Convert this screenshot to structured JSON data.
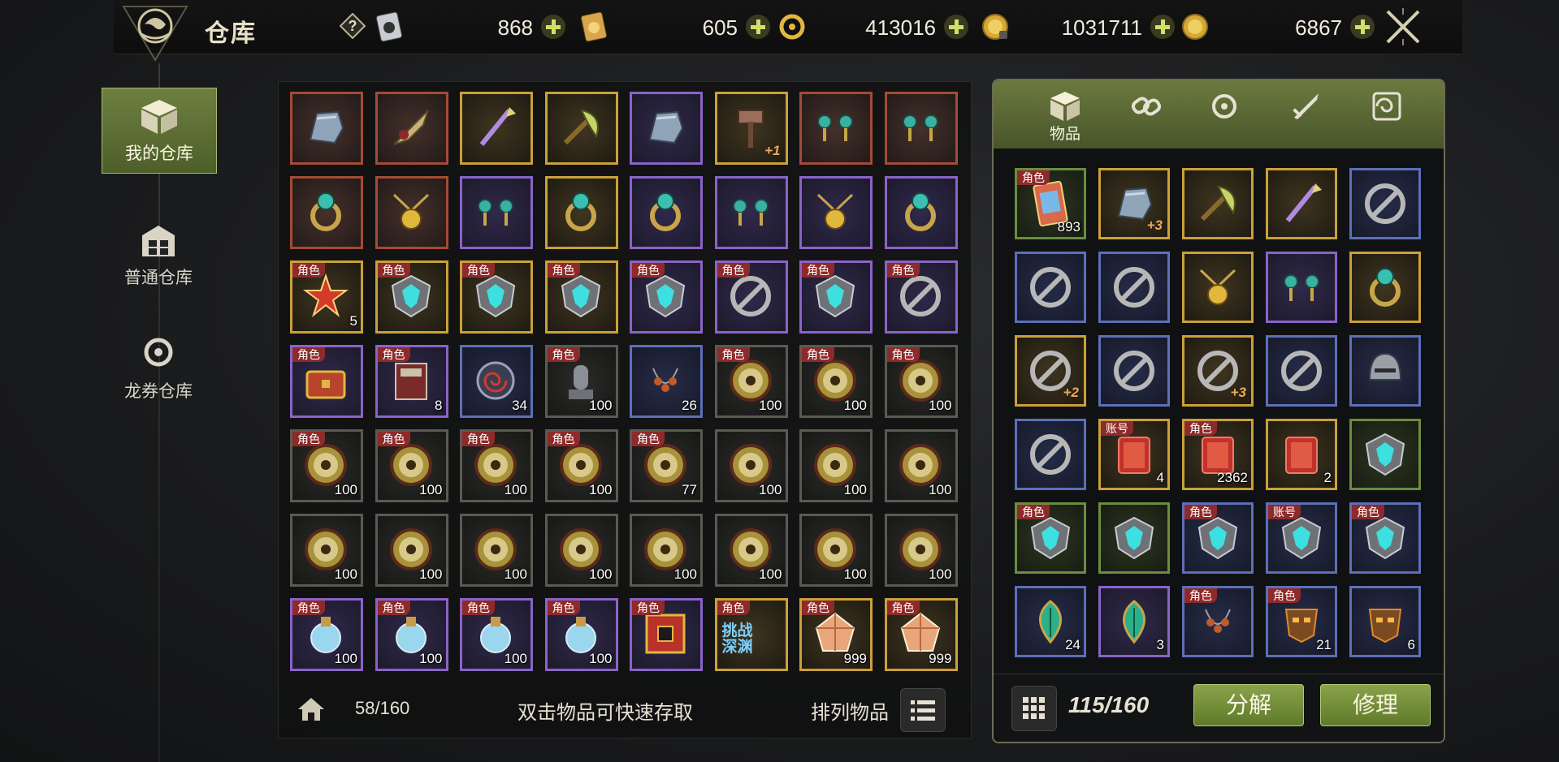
{
  "header": {
    "title": "仓库",
    "currencies": [
      {
        "icon": "ticket-card-icon",
        "value": "868"
      },
      {
        "icon": "coupon-card-icon",
        "value": "605"
      },
      {
        "icon": "dragon-coupon-icon",
        "value": "413016"
      },
      {
        "icon": "bound-gold-icon",
        "value": "1031711"
      },
      {
        "icon": "gold-coin-icon",
        "value": "6867"
      }
    ]
  },
  "nav": {
    "items": [
      {
        "label": "我的仓库",
        "icon": "box-icon",
        "active": true
      },
      {
        "label": "普通仓库",
        "icon": "warehouse-icon",
        "active": false
      },
      {
        "label": "龙券仓库",
        "icon": "dragon-coupon-icon",
        "active": false
      }
    ]
  },
  "left_grid": {
    "slots": [
      {
        "q": "red",
        "art": "gauntlet"
      },
      {
        "q": "red",
        "art": "blade"
      },
      {
        "q": "gold",
        "art": "spear"
      },
      {
        "q": "gold",
        "art": "axe"
      },
      {
        "q": "purple",
        "art": "gauntlet"
      },
      {
        "q": "gold",
        "art": "hammer",
        "enh": "+1"
      },
      {
        "q": "red",
        "art": "earring"
      },
      {
        "q": "red",
        "art": "earring"
      },
      {
        "q": "red",
        "art": "ring"
      },
      {
        "q": "red",
        "art": "amulet"
      },
      {
        "q": "purple",
        "art": "earring"
      },
      {
        "q": "gold",
        "art": "ring"
      },
      {
        "q": "purple",
        "art": "ring"
      },
      {
        "q": "purple",
        "art": "earring"
      },
      {
        "q": "purple",
        "art": "amulet"
      },
      {
        "q": "purple",
        "art": "ring"
      },
      {
        "q": "gold",
        "art": "star",
        "tag": "角色",
        "cnt": "5"
      },
      {
        "q": "gold",
        "art": "shield",
        "tag": "角色"
      },
      {
        "q": "gold",
        "art": "shield",
        "tag": "角色"
      },
      {
        "q": "gold",
        "art": "shield",
        "tag": "角色"
      },
      {
        "q": "purple",
        "art": "shield",
        "tag": "角色"
      },
      {
        "q": "purple",
        "art": "ban",
        "tag": "角色"
      },
      {
        "q": "purple",
        "art": "shield",
        "tag": "角色"
      },
      {
        "q": "purple",
        "art": "ban",
        "tag": "角色"
      },
      {
        "q": "purple",
        "art": "chest",
        "tag": "角色"
      },
      {
        "q": "purple",
        "art": "book",
        "tag": "角色",
        "cnt": "8"
      },
      {
        "q": "blue",
        "art": "spiral",
        "cnt": "34"
      },
      {
        "q": "dark",
        "art": "statue",
        "tag": "角色",
        "cnt": "100"
      },
      {
        "q": "blue",
        "art": "beads",
        "cnt": "26"
      },
      {
        "q": "dark",
        "art": "medal",
        "tag": "角色",
        "cnt": "100"
      },
      {
        "q": "dark",
        "art": "medal",
        "tag": "角色",
        "cnt": "100"
      },
      {
        "q": "dark",
        "art": "medal",
        "tag": "角色",
        "cnt": "100"
      },
      {
        "q": "dark",
        "art": "medal",
        "tag": "角色",
        "cnt": "100"
      },
      {
        "q": "dark",
        "art": "medal",
        "tag": "角色",
        "cnt": "100"
      },
      {
        "q": "dark",
        "art": "medal",
        "tag": "角色",
        "cnt": "100"
      },
      {
        "q": "dark",
        "art": "medal",
        "tag": "角色",
        "cnt": "100"
      },
      {
        "q": "dark",
        "art": "medal",
        "tag": "角色",
        "cnt": "77"
      },
      {
        "q": "dark",
        "art": "medal",
        "cnt": "100"
      },
      {
        "q": "dark",
        "art": "medal",
        "cnt": "100"
      },
      {
        "q": "dark",
        "art": "medal",
        "cnt": "100"
      },
      {
        "q": "dark",
        "art": "medal",
        "cnt": "100"
      },
      {
        "q": "dark",
        "art": "medal",
        "cnt": "100"
      },
      {
        "q": "dark",
        "art": "medal",
        "cnt": "100"
      },
      {
        "q": "dark",
        "art": "medal",
        "cnt": "100"
      },
      {
        "q": "dark",
        "art": "medal",
        "cnt": "100"
      },
      {
        "q": "dark",
        "art": "medal",
        "cnt": "100"
      },
      {
        "q": "dark",
        "art": "medal",
        "cnt": "100"
      },
      {
        "q": "dark",
        "art": "medal",
        "cnt": "100"
      },
      {
        "q": "purple",
        "art": "potion",
        "tag": "角色",
        "cnt": "100"
      },
      {
        "q": "purple",
        "art": "potion",
        "tag": "角色",
        "cnt": "100"
      },
      {
        "q": "purple",
        "art": "potion",
        "tag": "角色",
        "cnt": "100"
      },
      {
        "q": "purple",
        "art": "potion",
        "tag": "角色",
        "cnt": "100"
      },
      {
        "q": "purple",
        "art": "cube",
        "tag": "角色"
      },
      {
        "q": "gold",
        "art": "text",
        "tag": "角色",
        "txt": "挑战\n深渊"
      },
      {
        "q": "gold",
        "art": "crystal",
        "tag": "角色",
        "cnt": "999"
      },
      {
        "q": "gold",
        "art": "crystal",
        "tag": "角色",
        "cnt": "999"
      }
    ],
    "count": "58/160",
    "hint": "双击物品可快速存取",
    "sort_label": "排列物品"
  },
  "right_panel": {
    "tabs": [
      {
        "icon": "box-icon",
        "label": "物品"
      },
      {
        "icon": "chain-icon",
        "label": ""
      },
      {
        "icon": "dragon-coupon-icon",
        "label": ""
      },
      {
        "icon": "sword-icon",
        "label": ""
      },
      {
        "icon": "spiral-icon",
        "label": ""
      }
    ],
    "slots": [
      {
        "q": "green",
        "art": "card",
        "tag": "角色",
        "cnt": "893"
      },
      {
        "q": "gold",
        "art": "gauntlet",
        "enh": "+3"
      },
      {
        "q": "gold",
        "art": "axe"
      },
      {
        "q": "gold",
        "art": "spear"
      },
      {
        "q": "blue",
        "art": "ban"
      },
      {
        "q": "blue",
        "art": "ban"
      },
      {
        "q": "blue",
        "art": "ban"
      },
      {
        "q": "gold",
        "art": "amulet"
      },
      {
        "q": "purple",
        "art": "earring"
      },
      {
        "q": "gold",
        "art": "ring"
      },
      {
        "q": "gold",
        "art": "ban",
        "enh": "+2"
      },
      {
        "q": "blue",
        "art": "ban"
      },
      {
        "q": "gold",
        "art": "ban",
        "enh": "+3"
      },
      {
        "q": "blue",
        "art": "ban"
      },
      {
        "q": "blue",
        "art": "helm"
      },
      {
        "q": "blue",
        "art": "ban"
      },
      {
        "q": "gold",
        "art": "redbox",
        "tag": "账号",
        "cnt": "4"
      },
      {
        "q": "gold",
        "art": "redbox",
        "tag": "角色",
        "cnt": "2362"
      },
      {
        "q": "gold",
        "art": "redbox",
        "cnt": "2"
      },
      {
        "q": "green",
        "art": "shield"
      },
      {
        "q": "green",
        "art": "shield",
        "tag": "角色"
      },
      {
        "q": "green",
        "art": "shield"
      },
      {
        "q": "blue",
        "art": "shield",
        "tag": "角色"
      },
      {
        "q": "blue",
        "art": "shield",
        "tag": "账号"
      },
      {
        "q": "blue",
        "art": "shield",
        "tag": "角色"
      },
      {
        "q": "blue",
        "art": "leaf",
        "cnt": "24"
      },
      {
        "q": "purple",
        "art": "leaf",
        "cnt": "3"
      },
      {
        "q": "blue",
        "art": "beads",
        "tag": "角色"
      },
      {
        "q": "blue",
        "art": "mask",
        "tag": "角色",
        "cnt": "21"
      },
      {
        "q": "blue",
        "art": "mask",
        "cnt": "6"
      }
    ],
    "count": "115/160",
    "disassemble_label": "分解",
    "repair_label": "修理"
  },
  "colors": {
    "accent": "#6d7f40",
    "red": "#a54a36",
    "purple": "#8a63c8",
    "gold": "#caa03a",
    "blue": "#5d6fb8",
    "green": "#6c8c3e"
  }
}
